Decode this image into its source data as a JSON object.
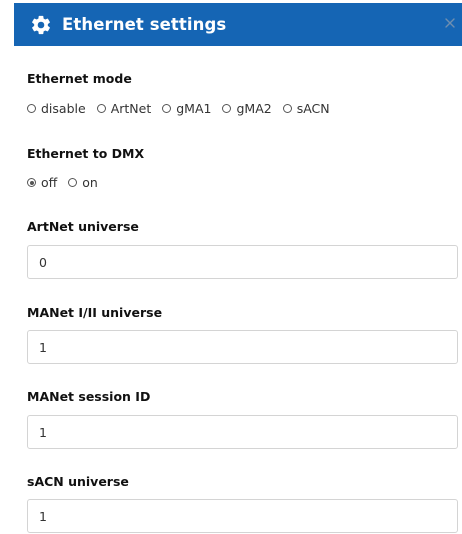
{
  "dialog": {
    "title": "Ethernet settings",
    "close_label": "×"
  },
  "ethernet_mode": {
    "label": "Ethernet mode",
    "options": [
      "disable",
      "ArtNet",
      "gMA1",
      "gMA2",
      "sACN"
    ],
    "selected": null
  },
  "ethernet_to_dmx": {
    "label": "Ethernet to DMX",
    "options": [
      "off",
      "on"
    ],
    "selected": "off"
  },
  "artnet_universe": {
    "label": "ArtNet universe",
    "value": "0"
  },
  "manet_universe": {
    "label": "MANet I/II universe",
    "value": "1"
  },
  "manet_session": {
    "label": "MANet session ID",
    "value": "1"
  },
  "sacn_universe": {
    "label": "sACN universe",
    "value": "1"
  },
  "colors": {
    "titlebar": "#1565b4",
    "title_text": "#ffffff"
  },
  "icons": {
    "title": "gear-icon",
    "close": "close-icon"
  }
}
